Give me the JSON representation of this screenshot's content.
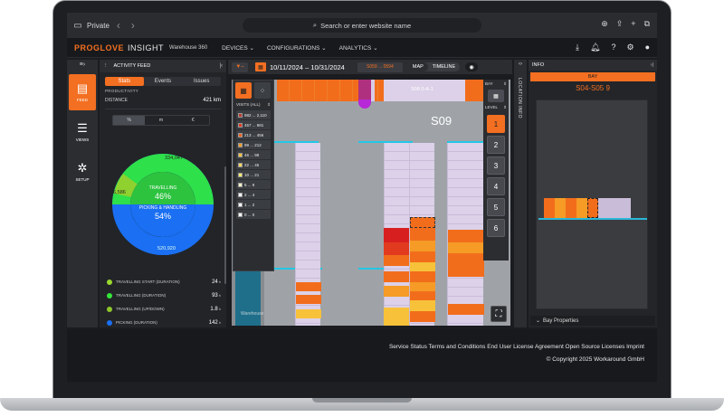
{
  "browser": {
    "private_label": "Private",
    "url_placeholder": "Search or enter website name"
  },
  "header": {
    "brand": "PROGLOVE",
    "product": "INSIGHT",
    "warehouse": "Warehouse 360",
    "nav": [
      {
        "label": "DEVICES"
      },
      {
        "label": "CONFIGURATIONS"
      },
      {
        "label": "ANALYTICS"
      }
    ]
  },
  "rail": {
    "items": [
      {
        "label": "FEED",
        "icon": "feed-icon"
      },
      {
        "label": "VIEWS",
        "icon": "views-icon"
      },
      {
        "label": "SETUP",
        "icon": "setup-icon"
      }
    ]
  },
  "feed": {
    "title": "ACTIVITY FEED",
    "tabs": [
      "Stats",
      "Events",
      "Issues"
    ],
    "active_tab": "Stats",
    "section_label": "PRODUCTIVITY",
    "distance_label": "DISTANCE",
    "distance_value": "421 km",
    "unit_options": [
      "%",
      "m",
      "€"
    ],
    "donut": {
      "outer_top": "334,047",
      "outer_left": "86,586",
      "outer_bottom": "520,920",
      "travelling_label": "TRAVELLING",
      "travelling_pct": "46%",
      "picking_label": "PICKING & HANDLING",
      "picking_pct": "54%",
      "colors": {
        "green": "#2ee04a",
        "olive": "#8fd12f",
        "blue": "#1a6ff2"
      }
    },
    "legend": [
      {
        "label": "TRAVELLING START (DURATION)",
        "value": "24",
        "unit": "h",
        "color": "#9ad82f"
      },
      {
        "label": "TRAVELLING (DURATION)",
        "value": "93",
        "unit": "h",
        "color": "#35e63a"
      },
      {
        "label": "TRAVELLING (UP/DOWN)",
        "value": "1.8",
        "unit": "h",
        "color": "#8fc72a"
      },
      {
        "label": "PICKING (DURATION)",
        "value": "142",
        "unit": "h",
        "color": "#1a6ff2"
      }
    ]
  },
  "map_toolbar": {
    "date_range": "10/11/2024 – 10/31/2024",
    "location": "S059 ... 0594",
    "view_options": [
      "MAP",
      "TIMELINE"
    ],
    "active_view": "MAP"
  },
  "map": {
    "aisle_label": "S08 0-A-1",
    "zone_label": "S09",
    "watermark": "Warehouse"
  },
  "visits": {
    "title": "VISITS (ALL)",
    "buckets": [
      {
        "label": "982 ... 2,110",
        "color": "#c0392b"
      },
      {
        "label": "457 ... 981",
        "color": "#e23a1f"
      },
      {
        "label": "213 ... 456",
        "color": "#f1641e"
      },
      {
        "label": "99 ... 212",
        "color": "#f59b26"
      },
      {
        "label": "46 ... 98",
        "color": "#f7c23a"
      },
      {
        "label": "22 ... 45",
        "color": "#f5d85a"
      },
      {
        "label": "10 ... 21",
        "color": "#f7ef6a"
      },
      {
        "label": "5 ... 9",
        "color": "#f4f4c8"
      },
      {
        "label": "2 ... 4",
        "color": "#ffffff"
      },
      {
        "label": "1 ... 2",
        "color": "#ffffff"
      },
      {
        "label": "0 ... 0",
        "color": "#ffffff"
      }
    ]
  },
  "level": {
    "bay_label": "BAY",
    "level_label": "LEVEL",
    "levels": [
      "1",
      "2",
      "3",
      "4",
      "5",
      "6"
    ],
    "active_level": "1"
  },
  "info": {
    "rail_label": "LOCATION INFO",
    "title": "INFO",
    "bay_header": "BAY",
    "bay_name": "S04-S05 9",
    "properties_label": "Bay Properties"
  },
  "footer": {
    "links": "Service Status Terms and Conditions End User License Agreement Open Source Licenses Imprint",
    "copyright": "© Copyright 2025 Workaround GmbH"
  }
}
